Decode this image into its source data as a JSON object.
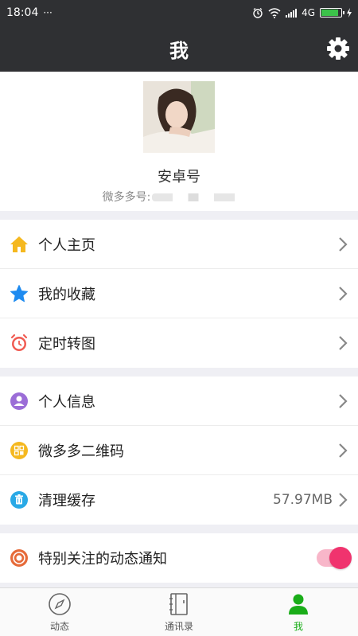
{
  "status_bar": {
    "time": "18:04",
    "dots": "···",
    "network": "4G"
  },
  "header": {
    "title": "我"
  },
  "profile": {
    "name": "安卓号",
    "account_label": "微多多号:"
  },
  "menu_groups": [
    {
      "items": [
        {
          "label": "个人主页",
          "icon": "home-icon",
          "color": "#f5b81f"
        },
        {
          "label": "我的收藏",
          "icon": "star-icon",
          "color": "#1e8bf0"
        },
        {
          "label": "定时转图",
          "icon": "alarm-clock-icon",
          "color": "#f05b52"
        }
      ]
    },
    {
      "items": [
        {
          "label": "个人信息",
          "icon": "person-icon",
          "color": "#9b6dd7"
        },
        {
          "label": "微多多二维码",
          "icon": "qr-code-icon",
          "color": "#f5b81f"
        },
        {
          "label": "清理缓存",
          "icon": "trash-icon",
          "color": "#29a9e6",
          "value": "57.97MB"
        }
      ]
    },
    {
      "items": [
        {
          "label": "特别关注的动态通知",
          "icon": "target-icon",
          "color": "#e66b3a",
          "toggle": true
        }
      ]
    }
  ],
  "tabs": [
    {
      "label": "动态",
      "icon": "compass-icon",
      "active": false
    },
    {
      "label": "通讯录",
      "icon": "contacts-book-icon",
      "active": false
    },
    {
      "label": "我",
      "icon": "me-person-icon",
      "active": true
    }
  ],
  "colors": {
    "header_bg": "#2f3033",
    "active_tab": "#1aad19",
    "toggle_on": "#f0336e"
  }
}
